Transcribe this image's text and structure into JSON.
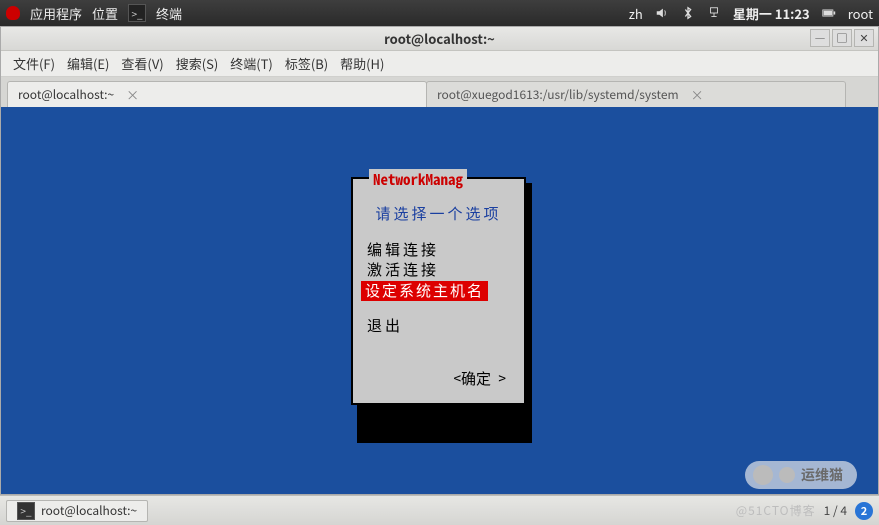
{
  "top_panel": {
    "app_menu": "应用程序",
    "places_menu": "位置",
    "running_app": "终端",
    "ime": "zh",
    "day_time": "星期一  11:23",
    "user": "root"
  },
  "window": {
    "title": "root@localhost:~"
  },
  "menubar": {
    "file": "文件(F)",
    "edit": "编辑(E)",
    "view": "查看(V)",
    "search": "搜索(S)",
    "terminal": "终端(T)",
    "tabs": "标签(B)",
    "help": "帮助(H)"
  },
  "tabs": {
    "active": "root@localhost:~",
    "inactive": "root@xuegod1613:/usr/lib/systemd/system"
  },
  "tui": {
    "title": "NetworkManag",
    "prompt": "请选择一个选项",
    "options": {
      "edit": "编辑连接",
      "activate": "激活连接",
      "hostname": "设定系统主机名"
    },
    "quit": "退出",
    "ok": "<确定 >"
  },
  "taskbar": {
    "task1": "root@localhost:~",
    "pager": "1 / 4",
    "badge": "2"
  },
  "watermark": {
    "pill": "运维猫",
    "faint": "@51CTO博客"
  }
}
